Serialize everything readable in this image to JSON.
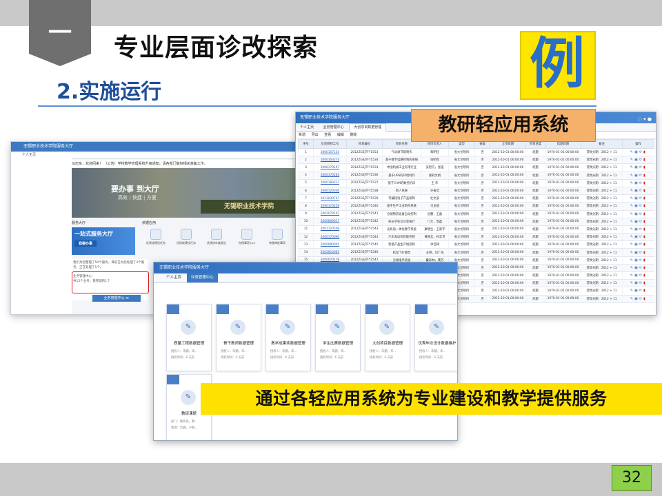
{
  "slide": {
    "section_number": "一",
    "title": "专业层面诊改探索",
    "subtitle": "2.实施运行",
    "example_char": "例",
    "app_label": "教研轻应用系统",
    "caption": "通过各轻应用系统为专业建设和教学提供服务",
    "page_number": "32"
  },
  "shot1": {
    "window_title": "无锡职业技术学院服务大厅",
    "tab": "个人主页",
    "notice": "马忠东，欢迎回来！  （公告）学校教学管理系统升级通知，请各部门做好相关准备工作。",
    "banner_title": "要办事 到大厅",
    "banner_sub": "高效 | 快捷 | 方便",
    "banner_sign": "无锡职业技术学院",
    "service_title": "服务大厅",
    "service_card_title": "一站式服务大厅",
    "service_card_button": "我要办事",
    "apps_title": "依据应用",
    "apps": [
      "优质校建设任务",
      "优质校建设任务",
      "优质校年度报告",
      "办理事项入口",
      "待我审批事项"
    ],
    "user_notice_1": "我们为您整理了50个服务，目前已为您处理了3个服务，正在处理了1个。",
    "user_panel_title": "业务管理中心",
    "user_notice_2": "共15个业务，我管理的1个",
    "center_button": "业务管理中心 ≫"
  },
  "shot2": {
    "window_title": "无锡职业技术学院服务大厅",
    "tabs": [
      "个人主页",
      "业务管理中心",
      "大创项目数据管理"
    ],
    "toolbar": [
      "新增",
      "导出",
      "查看",
      "编辑",
      "删除"
    ],
    "headers": [
      "序号",
      "负责教师工号",
      "项目编号",
      "项目名称",
      "项目负责人",
      "类型",
      "省级",
      "立项日期",
      "项目进度",
      "结题日期",
      "备注",
      "操作"
    ],
    "rows": [
      [
        "1",
        "2000107154",
        "2012ZGSJTFY1553",
        "气动源节能制作",
        "蒋明红",
        "省大创项目",
        "否",
        "2012-10-01 00:00:00",
        "结题",
        "1970-01-01 00:00:00",
        "贷款分期：2012 + 11"
      ],
      [
        "2",
        "2000163274",
        "2012ZGSJTFY1534",
        "基于数字电路控制的系统",
        "张明亮",
        "省大创项目",
        "否",
        "2012-10-01 00:00:00",
        "结题",
        "1970-01-01 00:00:00",
        "贷款分期：2012 + 11"
      ],
      [
        "3",
        "2000170197",
        "2012ZGSJTFY1533",
        "中国机械工业有限行业",
        "吴智元，张强",
        "省大创项目",
        "否",
        "2012-10-01 00:00:00",
        "结题",
        "1970-01-01 00:00:00",
        "贷款分期：2012 + 11"
      ],
      [
        "4",
        "2000170263",
        "2012ZGSJTFY1536",
        "基于UPS的环境制作",
        "秦莉文娟",
        "省大创项目",
        "否",
        "2012-10-01 00:00:00",
        "结题",
        "1970-01-01 00:00:00",
        "贷款分期：2012 + 11"
      ],
      [
        "5",
        "2000180217",
        "2012ZGSJTFY1537",
        "基于CAM的数控机床",
        "王 伟",
        "省大创项目",
        "否",
        "2012-10-01 00:00:00",
        "结题",
        "1970-01-01 00:00:00",
        "贷款分期：2012 + 11"
      ],
      [
        "6",
        "2000120336",
        "2012ZGSJTFY1538",
        "新人系统",
        "许振华",
        "省大创项目",
        "否",
        "2012-10-01 00:00:00",
        "结题",
        "1970-01-01 00:00:00",
        "贷款分期：2012 + 11"
      ],
      [
        "7",
        "2011030747",
        "2012ZGSJTFY1539",
        "可编程电子产品研制",
        "杜文波",
        "省大创项目",
        "否",
        "2012-10-01 00:00:00",
        "结题",
        "1970-01-01 00:00:00",
        "贷款分期：2012 + 11"
      ],
      [
        "8",
        "2090170259",
        "2012ZGSJTFY1540",
        "基于生产工业制作系统",
        "马玉能",
        "省大创项目",
        "否",
        "2012-10-01 00:00:00",
        "结题",
        "1970-01-01 00:00:00",
        "贷款分期：2012 + 11"
      ],
      [
        "9",
        "2002070197",
        "2012ZGSJTFY1541",
        "仓储物流设备自动控制",
        "岳鹏，王磊",
        "省大创项目",
        "否",
        "2012-10-01 00:00:00",
        "结题",
        "1970-01-01 00:00:00",
        "贷款分期：2012 + 11"
      ],
      [
        "10",
        "2000600017",
        "2012ZGSJTFY1542",
        "校长学生信号等统计",
        "门元，周磊",
        "省大创项目",
        "否",
        "2012-10-01 00:00:00",
        "结题",
        "1970-01-01 00:00:00",
        "贷款分期：2012 + 11"
      ],
      [
        "11",
        "2001120508",
        "2012ZGSJTFY1543",
        "光机电一体化教学系统",
        "康晓生，王新宇",
        "省大创项目",
        "否",
        "2012-10-01 00:00:00",
        "结题",
        "1970-01-01 00:00:00",
        "贷款分期：2012 + 11"
      ],
      [
        "12",
        "2000170090",
        "2012ZGSJTFY1544",
        "汽车发动机智能控制",
        "黄婉云，孙云可",
        "省大创项目",
        "否",
        "2012-10-01 00:00:00",
        "结题",
        "1970-01-01 00:00:00",
        "贷款分期：2012 + 11"
      ],
      [
        "13",
        "2000080045",
        "2012ZGSJTFY1545",
        "智能产品生产线控制",
        "承佳锋",
        "省大创项目",
        "否",
        "2012-10-01 00:00:00",
        "结题",
        "1970-01-01 00:00:00",
        "贷款分期：2012 + 11"
      ],
      [
        "14",
        "2002010063",
        "2012ZGSJTFY1546",
        "机电飞行模型",
        "王明，刘广海",
        "省大创项目",
        "否",
        "2012-10-01 00:00:00",
        "结题",
        "1970-01-01 00:00:00",
        "贷款分期：2012 + 11"
      ],
      [
        "15",
        "2000070118",
        "2012ZGSJTFY1547",
        "无线电手语化",
        "戴寿林，龚苏",
        "省大创项目",
        "否",
        "2012-10-01 00:00:00",
        "结题",
        "1970-01-01 00:00:00",
        "贷款分期：2012 + 11"
      ],
      [
        "16",
        "2000040528",
        "2012ZGSJTFY1548",
        "物联网云平台监控系统",
        "王乐，郑雅婷",
        "省大创项目",
        "否",
        "2012-10-01 00:00:00",
        "结题",
        "1970-01-01 00:00:00",
        "贷款分期：2012 + 11"
      ],
      [
        "17",
        "2090640327",
        "2012ZGSJTFY1549",
        "未来光伏小超项目开发",
        "顾如，张松元",
        "省大创项目",
        "否",
        "2012-10-01 00:00:00",
        "结题",
        "1970-01-01 00:00:00",
        "贷款分期：2012 + 11"
      ],
      [
        "18",
        "2000046182",
        "2012ZGSJTFY1550",
        "基于电子功能实现系统",
        "龚卫东",
        "省大创项目",
        "否",
        "2012-10-01 00:00:00",
        "结题",
        "1970-01-01 00:00:00",
        "贷款分期：2012 + 11"
      ],
      [
        "19",
        "2010070608",
        "2012ZGSJTFY1551",
        "大学生素质拓展计划",
        "温康，孙杰",
        "省大创项目",
        "否",
        "2012-10-01 00:00:00",
        "结题",
        "1970-01-01 00:00:00",
        "贷款分期：2012 + 11"
      ],
      [
        "20",
        "2000030179",
        "2012ZGSJTFY1552",
        "大学生就业指导系统",
        "刘海",
        "省大创项目",
        "否",
        "2012-10-01 00:00:00",
        "结题",
        "1970-01-01 00:00:00",
        "贷款分期：2012 + 11"
      ]
    ]
  },
  "shot3": {
    "window_title": "无锡职业技术学院服务大厅",
    "tabs": [
      "个人主页",
      "业务管理中心"
    ],
    "cards": [
      {
        "title": "质量工程数据管理",
        "meta1": "授权人：朱鹏，华...",
        "meta2": "授权时间：6 天前"
      },
      {
        "title": "骨干教师数据管理",
        "meta1": "授权人：朱鹏，华...",
        "meta2": "授权时间：6 天前"
      },
      {
        "title": "教学成果奖数据管理",
        "meta1": "授权人：朱鹏，华...",
        "meta2": "授权时间：6 天前"
      },
      {
        "title": "学生比赛数据管理",
        "meta1": "授权人：朱鹏，华...",
        "meta2": "授权时间：6 天前"
      },
      {
        "title": "大创项目数据管理",
        "meta1": "授权人：朱鹏，华...",
        "meta2": "授权时间：6 天前"
      },
      {
        "title": "优秀毕业设计数据维护",
        "meta1": "授权人：朱鹏，华...",
        "meta2": "授权时间：6 天前"
      },
      {
        "title": "教研课题",
        "meta1": "部门：教务处，教...",
        "meta2": "管理：华鹏，宁敏..."
      }
    ]
  },
  "colors": {
    "accent_blue": "#2f6fbe",
    "caption_yellow": "#ffe100",
    "example_yellow": "#ffe600",
    "label_orange": "#f5b06a",
    "page_green": "#8ed04c"
  }
}
